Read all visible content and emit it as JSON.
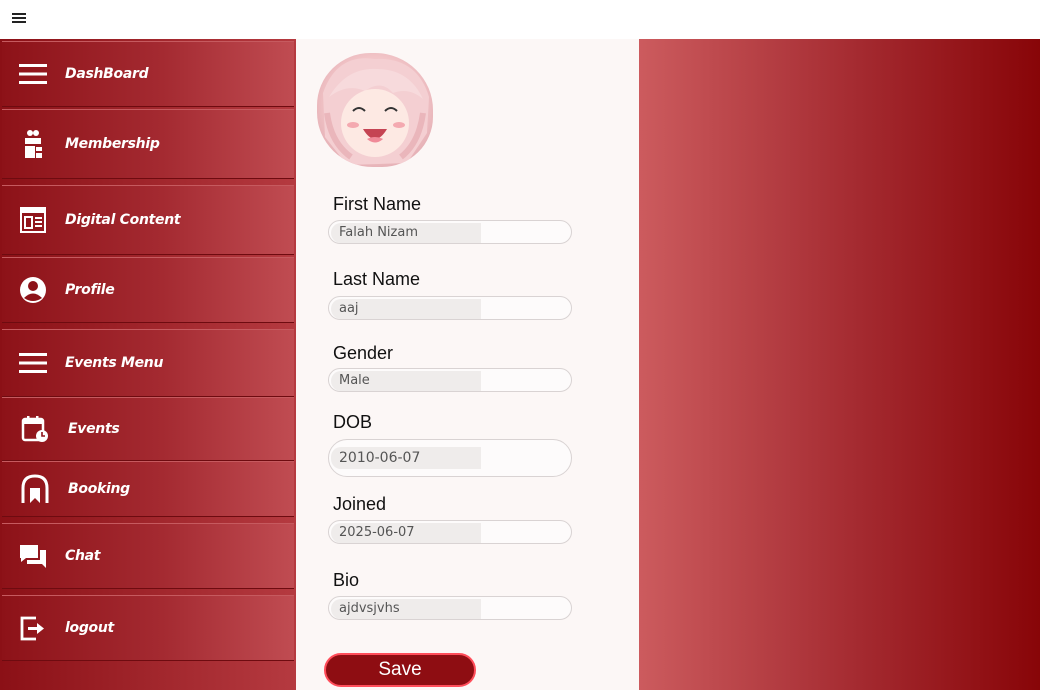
{
  "topbar": {
    "menu_icon": "hamburger-icon"
  },
  "sidebar": {
    "items": [
      {
        "label": "DashBoard",
        "icon": "hamburger-icon"
      },
      {
        "label": "Membership",
        "icon": "membership-icon"
      },
      {
        "label": "Digital Content",
        "icon": "digital-content-icon"
      },
      {
        "label": "Profile",
        "icon": "profile-icon"
      },
      {
        "label": "Events Menu",
        "icon": "hamburger-icon"
      },
      {
        "label": "Events",
        "icon": "calendar-icon"
      },
      {
        "label": "Booking",
        "icon": "booking-icon"
      },
      {
        "label": "Chat",
        "icon": "chat-icon"
      },
      {
        "label": "logout",
        "icon": "logout-icon"
      }
    ]
  },
  "profile": {
    "avatar": "avatar-image",
    "fields": [
      {
        "label": "First Name",
        "value": "Falah Nizam"
      },
      {
        "label": "Last Name",
        "value": "aaj"
      },
      {
        "label": "Gender",
        "value": "Male"
      },
      {
        "label": "DOB",
        "value": "2010-06-07"
      },
      {
        "label": "Joined",
        "value": "2025-06-07"
      },
      {
        "label": "Bio",
        "value": "ajdvsjvhs"
      }
    ],
    "save_label": "Save"
  },
  "colors": {
    "sidebar_dark": "#8b1016",
    "save_bg": "#8e0d12",
    "save_border": "#ff4d5a",
    "panel_bg": "#fcf7f6"
  }
}
